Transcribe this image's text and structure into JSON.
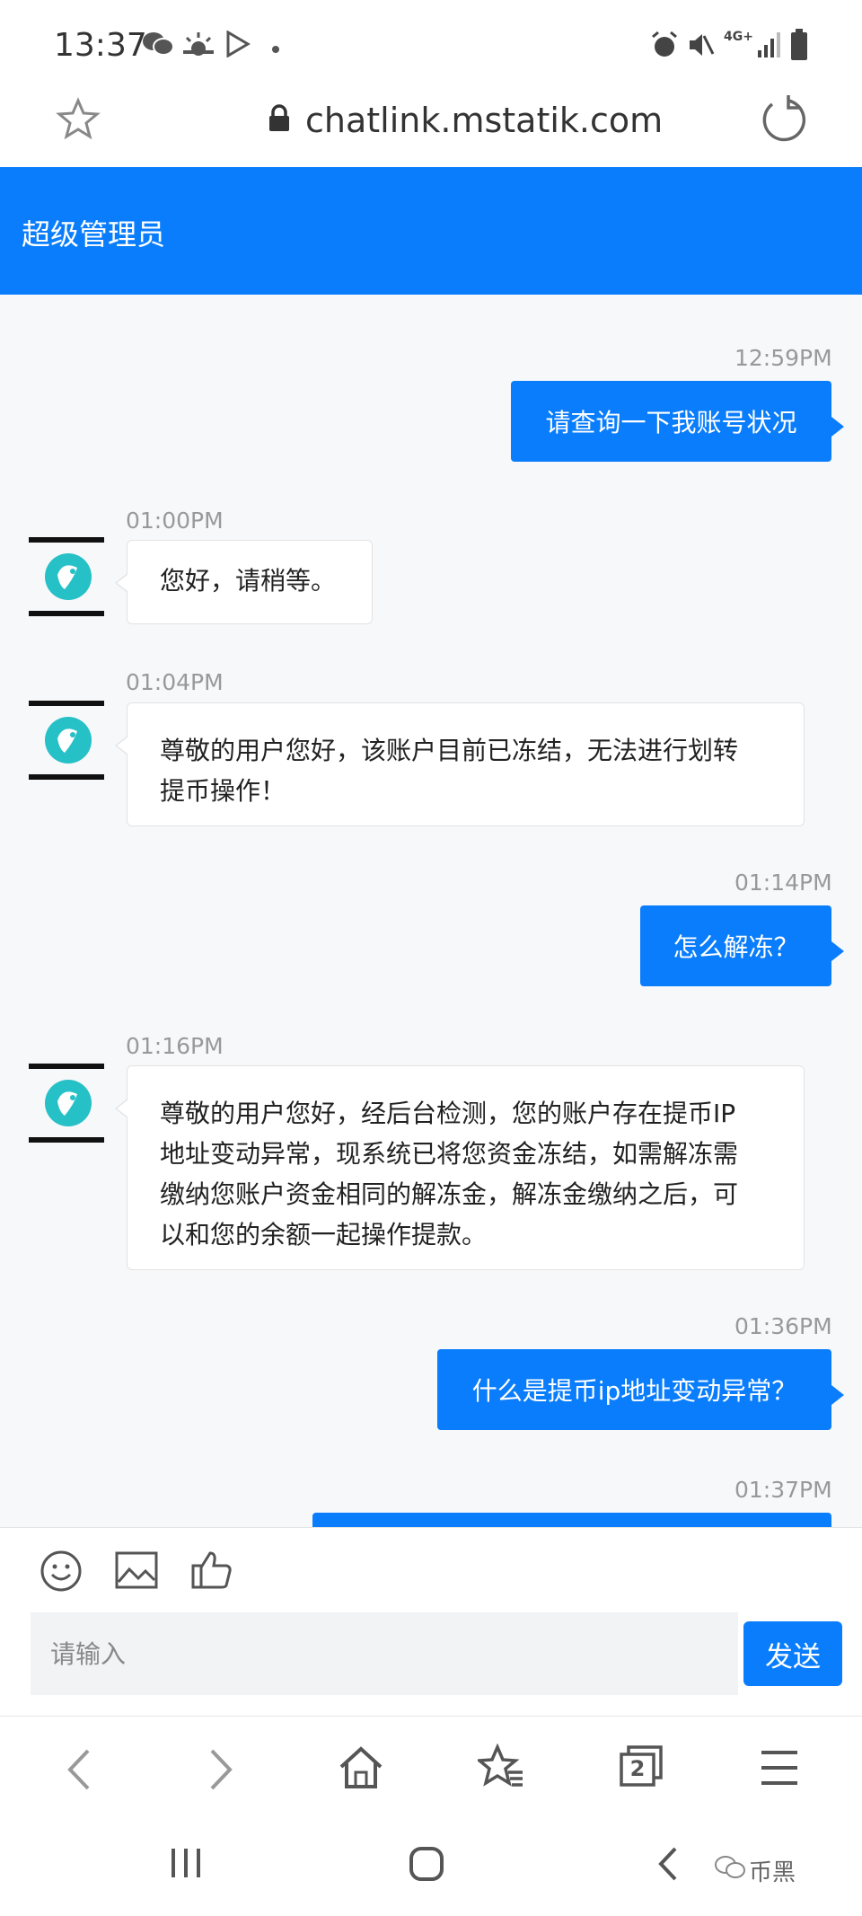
{
  "status_bar": {
    "time": "13:37",
    "network": "4G+"
  },
  "url_bar": {
    "url": "chatlink.mstatik.com"
  },
  "header": {
    "title": "超级管理员"
  },
  "messages": [
    {
      "direction": "out",
      "time": "12:59PM",
      "text": "请查询一下我账号状况"
    },
    {
      "direction": "in",
      "time": "01:00PM",
      "lines": [
        "您好，请稍等。"
      ]
    },
    {
      "direction": "in",
      "time": "01:04PM",
      "lines": [
        "尊敬的用户您好，该账户目前已冻结，无法进行划转",
        "提币操作！"
      ]
    },
    {
      "direction": "out",
      "time": "01:14PM",
      "text": "怎么解冻？"
    },
    {
      "direction": "in",
      "time": "01:16PM",
      "lines": [
        "尊敬的用户您好，经后台检测，您的账户存在提币IP",
        "地址变动异常，现系统已将您资金冻结，如需解冻需",
        "缴纳您账户资金相同的解冻金，解冻金缴纳之后，可",
        "以和您的余额一起操作提款。"
      ]
    },
    {
      "direction": "out",
      "time": "01:36PM",
      "text": "什么是提币ip地址变动异常？"
    },
    {
      "direction": "out",
      "time": "01:37PM",
      "text": ""
    }
  ],
  "composer": {
    "placeholder": "请输入",
    "send_label": "发送"
  },
  "browser_nav": {
    "tab_count": "2"
  },
  "watermark": "币黑",
  "colors": {
    "accent": "#0a7dfc",
    "chat_bg": "#f7f8fa",
    "avatar_teal": "#26c0c7"
  }
}
